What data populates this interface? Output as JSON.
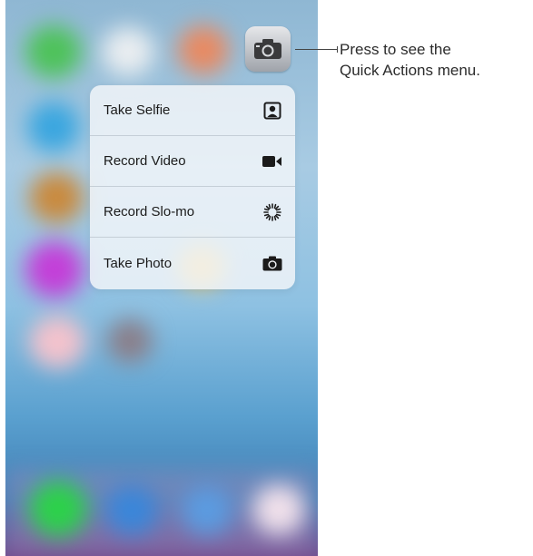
{
  "callout": {
    "line1": "Press to see the",
    "line2": "Quick Actions menu."
  },
  "home_screen": {
    "app_icon": "camera-icon"
  },
  "quick_actions": [
    {
      "label": "Take Selfie",
      "icon": "selfie-portrait-icon"
    },
    {
      "label": "Record Video",
      "icon": "video-camera-icon"
    },
    {
      "label": "Record Slo-mo",
      "icon": "slo-mo-icon"
    },
    {
      "label": "Take Photo",
      "icon": "camera-icon"
    }
  ],
  "colors": {
    "menu_background": "#f6f8fa",
    "text": "#1b1b1b",
    "callout_text": "#2c2c2c"
  }
}
